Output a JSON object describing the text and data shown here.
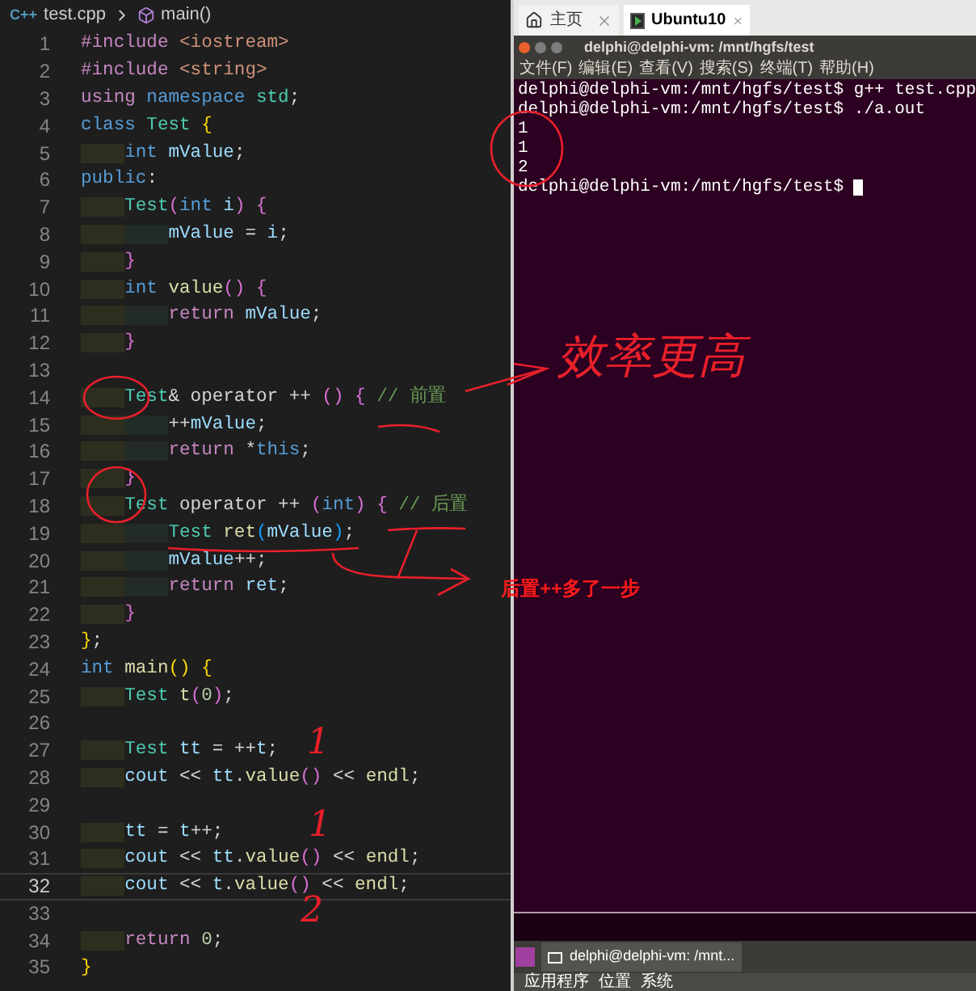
{
  "editor": {
    "breadcrumb": {
      "file_icon": "C++",
      "file": "test.cpp",
      "symbol": "main()"
    },
    "lines": [
      {
        "number": "1",
        "current": false,
        "tokens": [
          {
            "kind": "kw",
            "text": "#include"
          },
          {
            "kind": "str",
            "text": " <iostream>"
          }
        ]
      },
      {
        "number": "2",
        "current": false,
        "tokens": [
          {
            "kind": "kw",
            "text": "#include"
          },
          {
            "kind": "str",
            "text": " <string>"
          }
        ]
      },
      {
        "number": "3",
        "current": false,
        "tokens": [
          {
            "kind": "kw",
            "text": "using"
          },
          {
            "kind": "st",
            "text": " namespace"
          },
          {
            "kind": "ty",
            "text": " std"
          },
          {
            "kind": "op",
            "text": ";"
          }
        ]
      },
      {
        "number": "4",
        "current": false,
        "tokens": [
          {
            "kind": "st",
            "text": "class"
          },
          {
            "kind": "ty",
            "text": " Test"
          },
          {
            "kind": "b1",
            "text": " {"
          }
        ]
      },
      {
        "number": "5",
        "current": false,
        "tokens": [
          {
            "kind": "st",
            "text": "    int"
          },
          {
            "kind": "var",
            "text": " mValue"
          },
          {
            "kind": "op",
            "text": ";"
          }
        ]
      },
      {
        "number": "6",
        "current": false,
        "tokens": [
          {
            "kind": "st",
            "text": "public"
          },
          {
            "kind": "op",
            "text": ":"
          }
        ]
      },
      {
        "number": "7",
        "current": false,
        "tokens": [
          {
            "kind": "ty",
            "text": "    Test"
          },
          {
            "kind": "b2",
            "text": "("
          },
          {
            "kind": "st",
            "text": "int"
          },
          {
            "kind": "var",
            "text": " i"
          },
          {
            "kind": "b2",
            "text": ")"
          },
          {
            "kind": "b2",
            "text": " {"
          }
        ]
      },
      {
        "number": "8",
        "current": false,
        "tokens": [
          {
            "kind": "var",
            "text": "        mValue"
          },
          {
            "kind": "op",
            "text": " = "
          },
          {
            "kind": "var",
            "text": "i"
          },
          {
            "kind": "op",
            "text": ";"
          }
        ]
      },
      {
        "number": "9",
        "current": false,
        "tokens": [
          {
            "kind": "b2",
            "text": "    }"
          }
        ]
      },
      {
        "number": "10",
        "current": false,
        "tokens": [
          {
            "kind": "st",
            "text": "    int"
          },
          {
            "kind": "fn",
            "text": " value"
          },
          {
            "kind": "b2",
            "text": "()"
          },
          {
            "kind": "b2",
            "text": " {"
          }
        ]
      },
      {
        "number": "11",
        "current": false,
        "tokens": [
          {
            "kind": "kw",
            "text": "        return"
          },
          {
            "kind": "var",
            "text": " mValue"
          },
          {
            "kind": "op",
            "text": ";"
          }
        ]
      },
      {
        "number": "12",
        "current": false,
        "tokens": [
          {
            "kind": "b2",
            "text": "    }"
          }
        ]
      },
      {
        "number": "13",
        "current": false
      },
      {
        "number": "14",
        "current": false,
        "tokens": [
          {
            "kind": "ty",
            "text": "    Test"
          },
          {
            "kind": "op",
            "text": "& operator ++ "
          },
          {
            "kind": "b2",
            "text": "()"
          },
          {
            "kind": "b2",
            "text": " {"
          },
          {
            "kind": "com",
            "text": " // 前置"
          }
        ]
      },
      {
        "number": "15",
        "current": false,
        "tokens": [
          {
            "kind": "op",
            "text": "        ++"
          },
          {
            "kind": "var",
            "text": "mValue"
          },
          {
            "kind": "op",
            "text": ";"
          }
        ]
      },
      {
        "number": "16",
        "current": false,
        "tokens": [
          {
            "kind": "kw",
            "text": "        return"
          },
          {
            "kind": "op",
            "text": " *"
          },
          {
            "kind": "st",
            "text": "this"
          },
          {
            "kind": "op",
            "text": ";"
          }
        ]
      },
      {
        "number": "17",
        "current": false,
        "tokens": [
          {
            "kind": "b2",
            "text": "    }"
          }
        ]
      },
      {
        "number": "18",
        "current": false,
        "tokens": [
          {
            "kind": "ty",
            "text": "    Test"
          },
          {
            "kind": "op",
            "text": " operator ++ "
          },
          {
            "kind": "b2",
            "text": "("
          },
          {
            "kind": "st",
            "text": "int"
          },
          {
            "kind": "b2",
            "text": ")"
          },
          {
            "kind": "b2",
            "text": " {"
          },
          {
            "kind": "com",
            "text": " // 后置"
          }
        ]
      },
      {
        "number": "19",
        "current": false,
        "tokens": [
          {
            "kind": "ty",
            "text": "        Test"
          },
          {
            "kind": "fn",
            "text": " ret"
          },
          {
            "kind": "b3",
            "text": "("
          },
          {
            "kind": "var",
            "text": "mValue"
          },
          {
            "kind": "b3",
            "text": ")"
          },
          {
            "kind": "op",
            "text": ";"
          }
        ]
      },
      {
        "number": "20",
        "current": false,
        "tokens": [
          {
            "kind": "var",
            "text": "        mValue"
          },
          {
            "kind": "op",
            "text": "++;"
          }
        ]
      },
      {
        "number": "21",
        "current": false,
        "tokens": [
          {
            "kind": "kw",
            "text": "        return"
          },
          {
            "kind": "var",
            "text": " ret"
          },
          {
            "kind": "op",
            "text": ";"
          }
        ]
      },
      {
        "number": "22",
        "current": false,
        "tokens": [
          {
            "kind": "b2",
            "text": "    }"
          }
        ]
      },
      {
        "number": "23",
        "current": false,
        "tokens": [
          {
            "kind": "b1",
            "text": "}"
          },
          {
            "kind": "op",
            "text": ";"
          }
        ]
      },
      {
        "number": "24",
        "current": false,
        "tokens": [
          {
            "kind": "st",
            "text": "int"
          },
          {
            "kind": "fn",
            "text": " main"
          },
          {
            "kind": "b1",
            "text": "()"
          },
          {
            "kind": "b1",
            "text": " {"
          }
        ]
      },
      {
        "number": "25",
        "current": false,
        "tokens": [
          {
            "kind": "ty",
            "text": "    Test"
          },
          {
            "kind": "fn",
            "text": " t"
          },
          {
            "kind": "b2",
            "text": "("
          },
          {
            "kind": "num",
            "text": "0"
          },
          {
            "kind": "b2",
            "text": ")"
          },
          {
            "kind": "op",
            "text": ";"
          }
        ]
      },
      {
        "number": "26",
        "current": false
      },
      {
        "number": "27",
        "current": false,
        "tokens": [
          {
            "kind": "ty",
            "text": "    Test"
          },
          {
            "kind": "var",
            "text": " tt"
          },
          {
            "kind": "op",
            "text": " = ++"
          },
          {
            "kind": "var",
            "text": "t"
          },
          {
            "kind": "op",
            "text": ";"
          }
        ]
      },
      {
        "number": "28",
        "current": false,
        "tokens": [
          {
            "kind": "var",
            "text": "    cout"
          },
          {
            "kind": "op",
            "text": " << "
          },
          {
            "kind": "var",
            "text": "tt"
          },
          {
            "kind": "op",
            "text": "."
          },
          {
            "kind": "fn",
            "text": "value"
          },
          {
            "kind": "b2",
            "text": "()"
          },
          {
            "kind": "op",
            "text": " << "
          },
          {
            "kind": "fn",
            "text": "endl"
          },
          {
            "kind": "op",
            "text": ";"
          }
        ]
      },
      {
        "number": "29",
        "current": false
      },
      {
        "number": "30",
        "current": false,
        "tokens": [
          {
            "kind": "var",
            "text": "    tt"
          },
          {
            "kind": "op",
            "text": " = "
          },
          {
            "kind": "var",
            "text": "t"
          },
          {
            "kind": "op",
            "text": "++;"
          }
        ]
      },
      {
        "number": "31",
        "current": false,
        "tokens": [
          {
            "kind": "var",
            "text": "    cout"
          },
          {
            "kind": "op",
            "text": " << "
          },
          {
            "kind": "var",
            "text": "tt"
          },
          {
            "kind": "op",
            "text": "."
          },
          {
            "kind": "fn",
            "text": "value"
          },
          {
            "kind": "b2",
            "text": "()"
          },
          {
            "kind": "op",
            "text": " << "
          },
          {
            "kind": "fn",
            "text": "endl"
          },
          {
            "kind": "op",
            "text": ";"
          }
        ]
      },
      {
        "number": "32",
        "current": true,
        "tokens": [
          {
            "kind": "var",
            "text": "    cout"
          },
          {
            "kind": "op",
            "text": " << "
          },
          {
            "kind": "var",
            "text": "t"
          },
          {
            "kind": "op",
            "text": "."
          },
          {
            "kind": "fn",
            "text": "value"
          },
          {
            "kind": "b2",
            "text": "()"
          },
          {
            "kind": "op",
            "text": " << "
          },
          {
            "kind": "fn",
            "text": "endl"
          },
          {
            "kind": "op",
            "text": ";"
          }
        ]
      },
      {
        "number": "33",
        "current": false
      },
      {
        "number": "34",
        "current": false,
        "tokens": [
          {
            "kind": "kw",
            "text": "    return"
          },
          {
            "kind": "num",
            "text": " 0"
          },
          {
            "kind": "op",
            "text": ";"
          }
        ]
      },
      {
        "number": "35",
        "current": false,
        "tokens": [
          {
            "kind": "b1",
            "text": "}"
          }
        ]
      }
    ]
  },
  "terminal": {
    "tabs": [
      {
        "label": "主页",
        "selected": false
      },
      {
        "label": "Ubuntu10",
        "selected": true
      }
    ],
    "title": "delphi@delphi-vm: /mnt/hgfs/test",
    "menu": [
      "文件(F)",
      "编辑(E)",
      "查看(V)",
      "搜索(S)",
      "终端(T)",
      "帮助(H)"
    ],
    "lines": [
      "delphi@delphi-vm:/mnt/hgfs/test$ g++ test.cpp",
      "delphi@delphi-vm:/mnt/hgfs/test$ ./a.out",
      "1",
      "1",
      "2",
      "delphi@delphi-vm:/mnt/hgfs/test$ "
    ],
    "taskbar": {
      "window": "delphi@delphi-vm: /mnt..."
    },
    "panel": [
      "应用程序",
      "位置",
      "系统"
    ]
  },
  "annotations": {
    "handwritten": "效率更高",
    "note": "后置++多了一步",
    "marks": [
      "1",
      "1",
      "2"
    ]
  }
}
